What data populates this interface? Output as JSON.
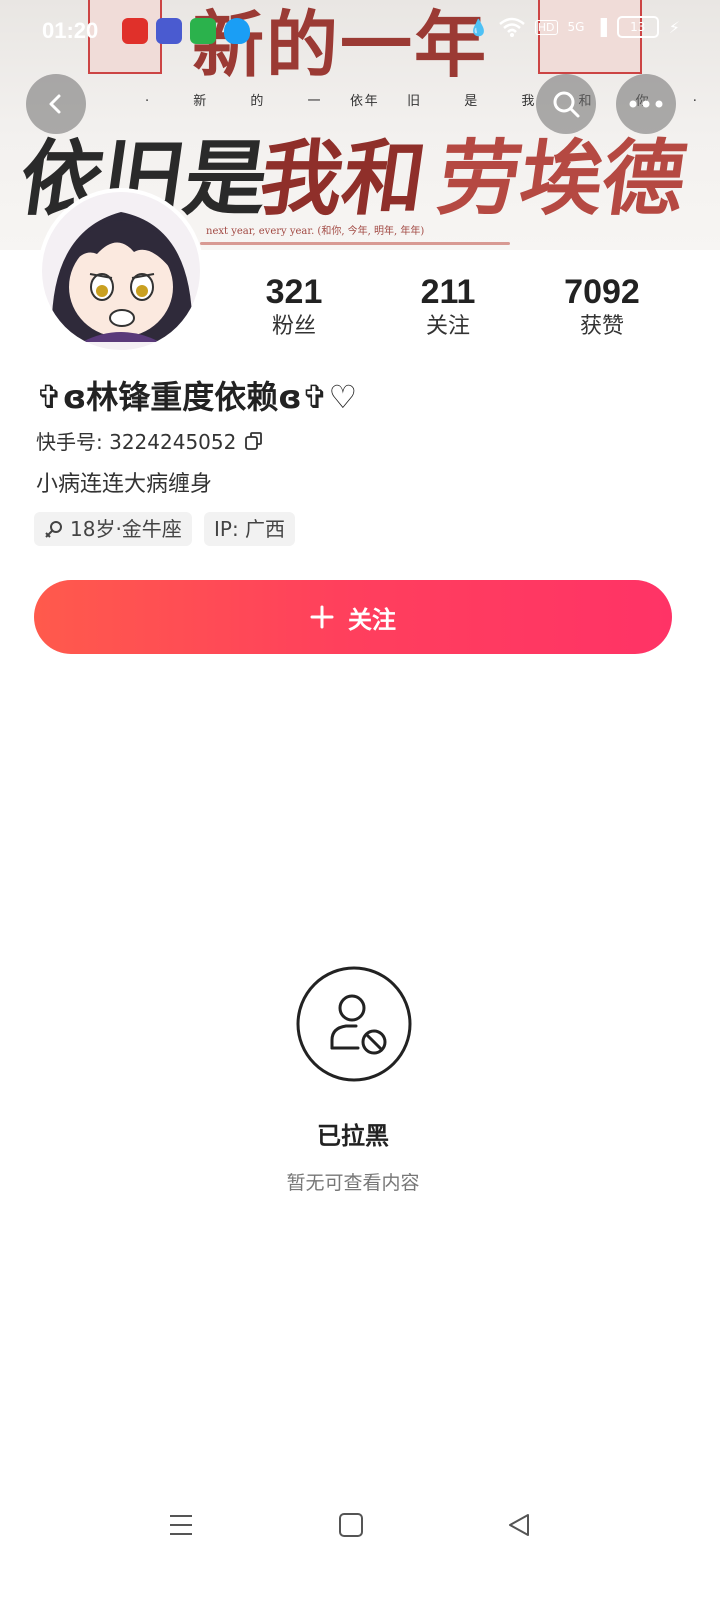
{
  "status_bar": {
    "time": "01:20",
    "network": "5G",
    "hd_label": "HD",
    "battery": "13"
  },
  "banner": {
    "headline": "新的一年",
    "small_left": "· 新 的 一 年",
    "small_right": "依 旧 是 我 和 你 ·",
    "slogan_dark": "依旧是",
    "slogan_red1": "我和",
    "slogan_red2": "劳埃德",
    "english_line": "next year, every year. (和你, 今年, 明年, 年年)"
  },
  "profile": {
    "stats": [
      {
        "value": "321",
        "label": "粉丝"
      },
      {
        "value": "211",
        "label": "关注"
      },
      {
        "value": "7092",
        "label": "获赞"
      }
    ],
    "nickname": "✞ɞ林锋重度依赖ɞ✞♡",
    "uid_label": "快手号: 3224245052",
    "bio": "小病连连大病缠身",
    "tags": [
      {
        "text": "18岁·金牛座",
        "icon": "female-icon"
      },
      {
        "text": "IP: 广西"
      }
    ]
  },
  "follow_button": {
    "label": "关注",
    "icon": "plus-icon"
  },
  "blocked": {
    "title": "已拉黑",
    "subtitle": "暂无可查看内容",
    "icon": "user-blocked-icon"
  },
  "colors": {
    "follow_start": "#ff5a4c",
    "follow_end": "#ff3366",
    "banner_red": "#9b3a34"
  }
}
